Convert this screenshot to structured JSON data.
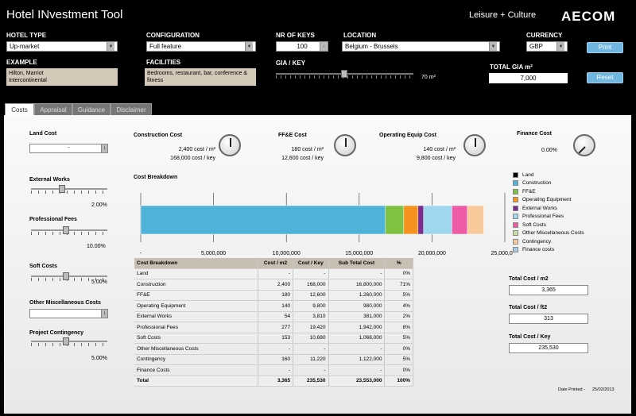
{
  "header": {
    "title": "Hotel INvestment Tool",
    "section": "Leisure + Culture",
    "brand": "AECOM"
  },
  "controls": {
    "hotel_type": {
      "label": "HOTEL TYPE",
      "value": "Up-market"
    },
    "configuration": {
      "label": "CONFIGURATION",
      "value": "Full feature"
    },
    "nr_keys": {
      "label": "NR OF KEYS",
      "value": "100"
    },
    "location": {
      "label": "LOCATION",
      "value": "Belgium - Brussels"
    },
    "currency": {
      "label": "CURRENCY",
      "value": "GBP"
    },
    "print_label": "Print",
    "reset_label": "Reset",
    "example": {
      "label": "EXAMPLE",
      "value": "Hilton, Marriot\nIntercontinental"
    },
    "facilities": {
      "label": "FACILITIES",
      "value": "Bedrooms, restaurant, bar, conference & fitness"
    },
    "gia_key": {
      "label": "GIA / KEY",
      "value": "70 m²"
    },
    "total_gia": {
      "label": "TOTAL GIA m²",
      "value": "7,000"
    }
  },
  "tabs": [
    "Costs",
    "Appraisal",
    "Guidance",
    "Disclaimer"
  ],
  "left": {
    "land_cost": {
      "label": "Land Cost",
      "value": "-"
    },
    "external_works": {
      "label": "External Works",
      "value": "2.00%",
      "level": 0.4
    },
    "professional_fees": {
      "label": "Professional Fees",
      "value": "10.00%",
      "level": 0.45
    },
    "soft_costs": {
      "label": "Soft Costs",
      "value": "5.00%",
      "level": 0.45
    },
    "other_misc": {
      "label": "Other Miscellaneous Costs"
    },
    "contingency": {
      "label": "Project Contingency",
      "value": "5.00%",
      "level": 0.45
    }
  },
  "cost_dials": {
    "construction": {
      "label": "Construction Cost",
      "line1": "2,400  cost / m²",
      "line2": "168,000  cost / key"
    },
    "ffe": {
      "label": "FF&E Cost",
      "line1": "180  cost / m²",
      "line2": "12,600  cost / key"
    },
    "opequip": {
      "label": "Operating Equip Cost",
      "line1": "140  cost / m²",
      "line2": "9,800  cost / key"
    },
    "finance": {
      "label": "Finance Cost",
      "line1": "0.00%"
    }
  },
  "chart_data": {
    "type": "bar",
    "title": "Cost Breakdown",
    "orientation": "horizontal-stacked",
    "xlim": [
      0,
      25000000
    ],
    "x_ticks": [
      "-",
      "5,000,000",
      "10,000,000",
      "15,000,000",
      "20,000,000",
      "25,000,000"
    ],
    "series": [
      {
        "name": "Land",
        "value": 0,
        "color": "#000000"
      },
      {
        "name": "Construction",
        "value": 16800000,
        "color": "#4fb3d9"
      },
      {
        "name": "FF&E",
        "value": 1260000,
        "color": "#7fc241"
      },
      {
        "name": "Operating Equipment",
        "value": 980000,
        "color": "#f5921e"
      },
      {
        "name": "External Works",
        "value": 381000,
        "color": "#7b2d8e"
      },
      {
        "name": "Soft Costs",
        "value": 1068000,
        "color": "#ee5aa6"
      },
      {
        "name": "Other Miscellaneous Costs",
        "value": 0,
        "color": "#c5e0a5"
      },
      {
        "name": "Professional Fees",
        "value": 1942000,
        "color": "#9fd8ee"
      },
      {
        "name": "Contingency",
        "value": 1122000,
        "color": "#f8c99a"
      },
      {
        "name": "Finance costs",
        "value": 0,
        "color": "#a6cde8"
      }
    ],
    "stack_order": [
      "Construction",
      "FF&E",
      "Operating Equipment",
      "External Works",
      "Professional Fees",
      "Soft Costs",
      "Contingency"
    ],
    "legend": [
      "Land",
      "Construction",
      "FF&E",
      "Operating Equipment",
      "External Works",
      "Professional Fees",
      "Soft Costs",
      "Other Miscellaneous Costs",
      "Contingency",
      "Finance costs"
    ]
  },
  "table": {
    "headers": [
      "Cost Breakdown",
      "Cost / m2",
      "Cost / Key",
      "Sub Total Cost",
      "%"
    ],
    "rows": [
      [
        "Land",
        "-",
        "-",
        "-",
        "0%"
      ],
      [
        "Construction",
        "2,400",
        "168,000",
        "16,800,000",
        "71%"
      ],
      [
        "FF&E",
        "180",
        "12,600",
        "1,260,000",
        "5%"
      ],
      [
        "Operating Equipment",
        "140",
        "9,800",
        "980,000",
        "4%"
      ],
      [
        "External Works",
        "54",
        "3,810",
        "381,000",
        "2%"
      ],
      [
        "Professional Fees",
        "277",
        "19,420",
        "1,942,000",
        "8%"
      ],
      [
        "Soft Costs",
        "153",
        "10,680",
        "1,068,000",
        "5%"
      ],
      [
        "Other Miscellaneous Costs",
        "-",
        "-",
        "-",
        "0%"
      ],
      [
        "Contingency",
        "160",
        "11,220",
        "1,122,000",
        "5%"
      ],
      [
        "Finance Costs",
        "-",
        "-",
        "-",
        "0%"
      ]
    ],
    "total": [
      "Total",
      "3,365",
      "235,530",
      "23,553,000",
      "100%"
    ]
  },
  "totals": {
    "per_m2": {
      "label": "Total Cost / m2",
      "value": "3,365"
    },
    "per_ft2": {
      "label": "Total Cost / ft2",
      "value": "313"
    },
    "per_key": {
      "label": "Total Cost / Key",
      "value": "235,530"
    }
  },
  "date_printed": {
    "label": "Date Printed -",
    "value": "25/02/2013"
  }
}
